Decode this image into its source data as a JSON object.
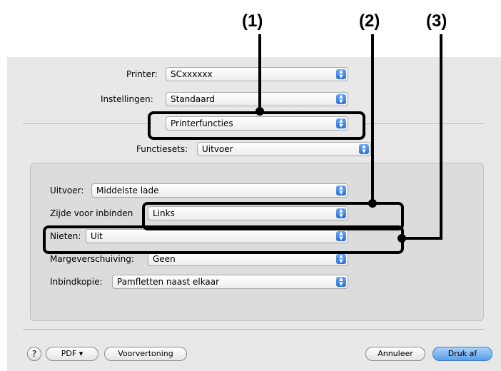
{
  "callouts": [
    "(1)",
    "(2)",
    "(3)"
  ],
  "printer": {
    "label": "Printer:",
    "value": "SCxxxxxx"
  },
  "settings": {
    "label": "Instellingen:",
    "value": "Standaard"
  },
  "panel_select": {
    "value": "Printerfuncties"
  },
  "feature_sets": {
    "label": "Functiesets:",
    "value": "Uitvoer"
  },
  "output": {
    "label": "Uitvoer:",
    "value": "Middelste lade"
  },
  "binding": {
    "label": "Zijde voor inbinden",
    "value": "Links"
  },
  "staple": {
    "label": "Nieten:",
    "value": "Uit"
  },
  "margin": {
    "label": "Margeverschuiving:",
    "value": "Geen"
  },
  "booklet": {
    "label": "Inbindkopie:",
    "value": "Pamfletten naast elkaar"
  },
  "footer": {
    "help": "?",
    "pdf": "PDF ▾",
    "preview": "Voorvertoning",
    "cancel": "Annuleer",
    "print": "Druk af"
  },
  "colors": {
    "accent": "#2c6fd6",
    "print_button": "#7fb6ee"
  }
}
